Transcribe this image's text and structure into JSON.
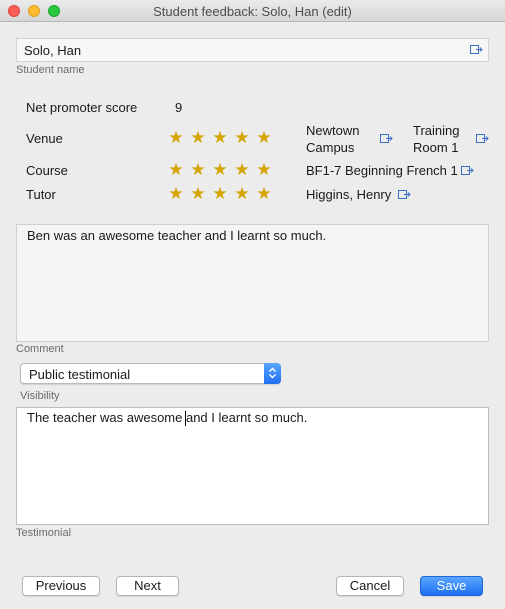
{
  "window": {
    "title": "Student feedback: Solo, Han (edit)"
  },
  "student": {
    "value": "Solo, Han",
    "caption": "Student name"
  },
  "nps": {
    "label": "Net promoter score",
    "value": "9"
  },
  "ratings": [
    {
      "label": "Venue",
      "stars": 5,
      "link_line1": "Newtown",
      "link_line2": "Campus",
      "link2_line1": "Training",
      "link2_line2": "Room 1"
    },
    {
      "label": "Course",
      "stars": 5,
      "link": "BF1-7 Beginning French 1"
    },
    {
      "label": "Tutor",
      "stars": 5,
      "link": "Higgins, Henry"
    }
  ],
  "comment": {
    "text": "Ben was an awesome teacher and I learnt so much.",
    "caption": "Comment"
  },
  "visibility": {
    "selected": "Public testimonial",
    "caption": "Visibility"
  },
  "testimonial": {
    "text": "The teacher was awesome and I learnt so much.",
    "caption": "Testimonial"
  },
  "buttons": {
    "previous": "Previous",
    "next": "Next",
    "cancel": "Cancel",
    "save": "Save"
  },
  "colors": {
    "star": "#d4a400",
    "accent": "#1d6ff2"
  },
  "icons": {
    "link": "open-link-icon",
    "select": "select-arrows-icon"
  }
}
